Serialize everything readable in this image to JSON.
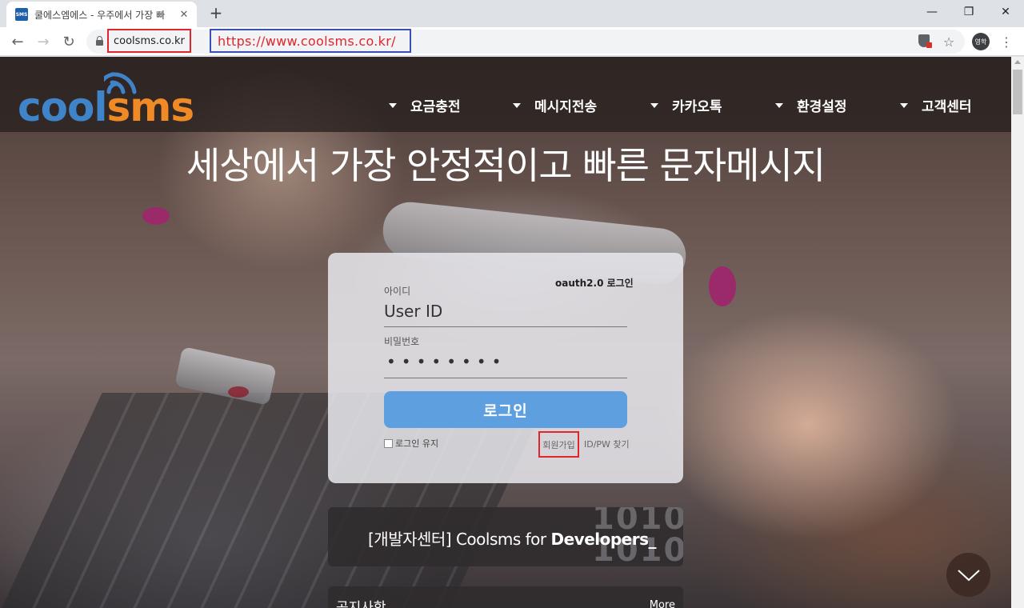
{
  "browser": {
    "tab_favicon": "SMS",
    "tab_title": "쿨에스엠에스 - 우주에서 가장 빠",
    "tab_close": "✕",
    "new_tab": "+",
    "window_min": "—",
    "window_restore": "❐",
    "window_close": "✕",
    "back": "←",
    "forward": "→",
    "reload": "↻",
    "url": "coolsms.co.kr",
    "url_annotation": "https://www.coolsms.co.kr/",
    "profile_label": "영학",
    "star": "☆",
    "menu": "⋮"
  },
  "site": {
    "logo_cool": "cool",
    "logo_sms": "sms",
    "nav": [
      "요금충전",
      "메시지전송",
      "카카오톡",
      "환경설정",
      "고객센터"
    ],
    "hero_title": "세상에서 가장 안정적이고 빠른 문자메시지"
  },
  "login": {
    "oauth_label": "oauth2.0 로그인",
    "id_label": "아이디",
    "id_value": "User ID",
    "pw_label": "비밀번호",
    "pw_value": "••••••••",
    "submit_label": "로그인",
    "keep_login_label": "로그인 유지",
    "signup_label": "회원가입",
    "find_label": "ID/PW 찾기"
  },
  "developers": {
    "prefix": "[개발자센터] Coolsms for ",
    "highlight": "Developers_",
    "bits_top": "1010",
    "bits_bottom": "1010"
  },
  "notice": {
    "title": "공지사항",
    "more": "More"
  },
  "colors": {
    "logo_blue": "#3f84c9",
    "logo_orange": "#f08a24",
    "login_button": "#5e9fe0",
    "annotation_red": "#e0262c",
    "annotation_blue": "#3b4fb8"
  }
}
